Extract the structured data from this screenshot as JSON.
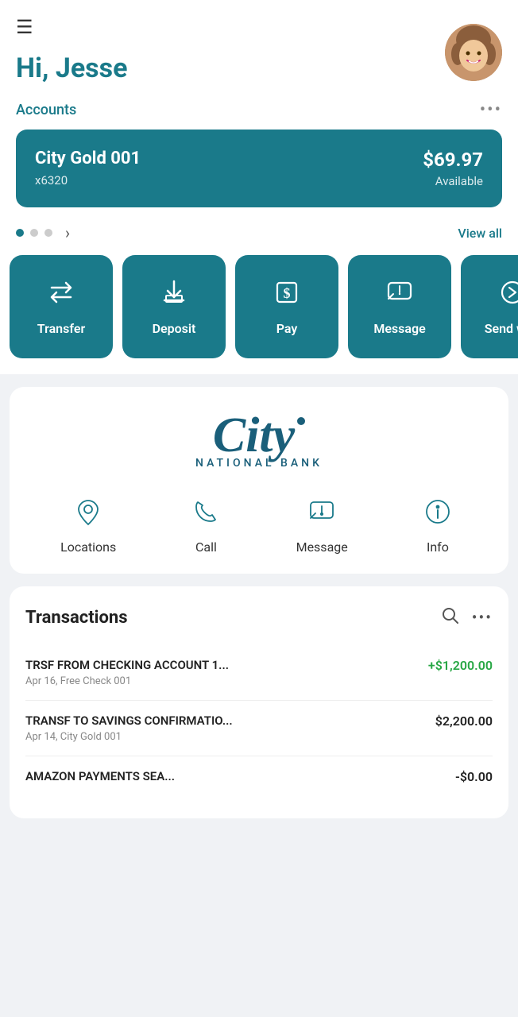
{
  "header": {
    "greeting": "Hi, Jesse",
    "hamburger_icon": "☰",
    "avatar_emoji": "😊"
  },
  "accounts": {
    "label": "Accounts",
    "more_label": "•••",
    "card": {
      "name": "City Gold 001",
      "number": "x6320",
      "balance": "$69.97",
      "balance_label": "Available"
    },
    "dots": [
      true,
      false,
      false
    ],
    "view_all": "View all"
  },
  "actions": [
    {
      "id": "transfer",
      "label": "Transfer",
      "icon": "⇄"
    },
    {
      "id": "deposit",
      "label": "Deposit",
      "icon": "↓"
    },
    {
      "id": "pay",
      "label": "Pay",
      "icon": "💲"
    },
    {
      "id": "message",
      "label": "Message",
      "icon": "✉"
    },
    {
      "id": "send-with",
      "label": "Send with",
      "icon": "→"
    }
  ],
  "bank": {
    "logo_city": "City",
    "logo_rest": "NATIONAL BANK",
    "actions": [
      {
        "id": "locations",
        "label": "Locations",
        "icon": "pin"
      },
      {
        "id": "call",
        "label": "Call",
        "icon": "phone"
      },
      {
        "id": "message",
        "label": "Message",
        "icon": "message"
      },
      {
        "id": "info",
        "label": "Info",
        "icon": "info"
      }
    ]
  },
  "transactions": {
    "title": "Transactions",
    "items": [
      {
        "description": "TRSF FROM CHECKING ACCOUNT 1...",
        "sub": "Apr 16, Free Check 001",
        "amount": "+$1,200.00",
        "type": "positive"
      },
      {
        "description": "TRANSF TO SAVINGS CONFIRMATIO...",
        "sub": "Apr 14, City Gold 001",
        "amount": "$2,200.00",
        "type": "negative"
      },
      {
        "description": "AMAZON PAYMENTS SEA...",
        "sub": "",
        "amount": "-$0.00",
        "type": "negative"
      }
    ]
  }
}
